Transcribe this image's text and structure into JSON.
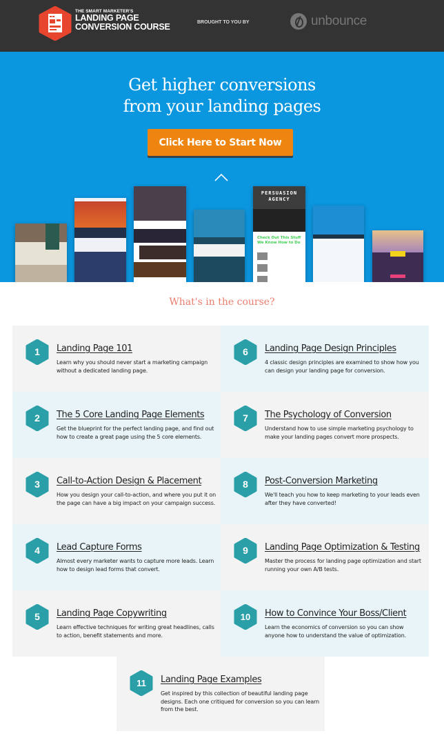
{
  "header": {
    "logo": {
      "small": "THE SMART MARKETER'S",
      "line1": "LANDING PAGE",
      "line2": "CONVERSION COURSE"
    },
    "brought_by": "BROUGHT TO YOU BY",
    "sponsor": "unbounce"
  },
  "hero": {
    "title_line1": "Get higher conversions",
    "title_line2": "from your landing pages",
    "cta_label": "Click Here to Start Now",
    "scroll_icon": "chevron-up-icon",
    "thumbnails": {
      "persuasion_title": "PERSUASION AGENCY",
      "persuasion_sub": "Check Out This Stuff We Know How to Do"
    }
  },
  "course": {
    "heading": "What's in the course?",
    "accent_color": "#2a9fa8",
    "lessons": [
      {
        "number": "1",
        "title": "Landing Page 101",
        "description": "Learn why you should never start a marketing campaign without a dedicated landing page."
      },
      {
        "number": "2",
        "title": "The 5 Core Landing Page Elements",
        "description": "Get the blueprint for the perfect landing page, and find out how to create a great page using the 5 core elements."
      },
      {
        "number": "3",
        "title": "Call-to-Action Design & Placement",
        "description": "How you design your call-to-action, and where you put it on the page can have a big impact on your campaign success."
      },
      {
        "number": "4",
        "title": "Lead Capture Forms",
        "description": "Almost every marketer wants to capture more leads. Learn how to design lead forms that convert."
      },
      {
        "number": "5",
        "title": "Landing Page Copywriting",
        "description": "Learn effective techniques for writing great headlines, calls to action, benefit statements and more."
      },
      {
        "number": "6",
        "title": "Landing Page Design Principles",
        "description": "4 classic design principles are examined to show how you can design your landing page for conversion."
      },
      {
        "number": "7",
        "title": "The Psychology of Conversion",
        "description": "Understand how to use simple marketing psychology to make your landing pages convert more prospects."
      },
      {
        "number": "8",
        "title": "Post-Conversion Marketing",
        "description": "We'll teach you how to keep marketing to your leads even after they have converted!"
      },
      {
        "number": "9",
        "title": "Landing Page Optimization & Testing",
        "description": "Master the process for landing page optimization and start running your own A/B tests."
      },
      {
        "number": "10",
        "title": "How to Convince Your Boss/Client",
        "description": "Learn the economics of conversion so you can show anyone how to understand the value of optimization."
      },
      {
        "number": "11",
        "title": "Landing Page Examples",
        "description": "Get inspired by this collection of beautiful landing page designs. Each one critiqued for conversion so you can learn from the best."
      }
    ]
  }
}
